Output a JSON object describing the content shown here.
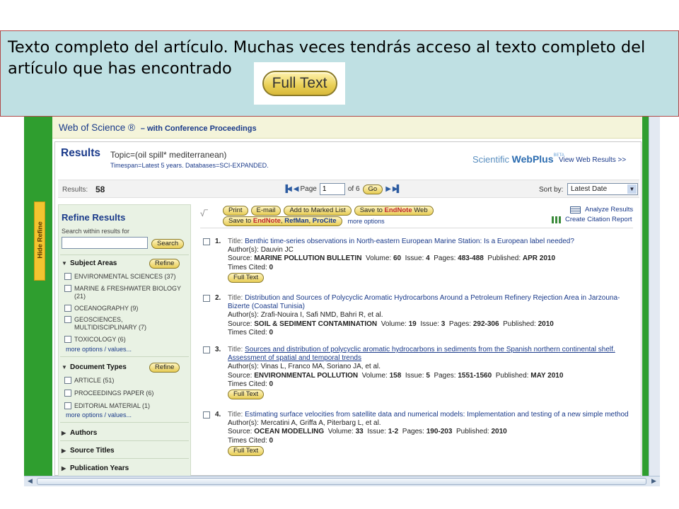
{
  "caption": {
    "text": "Texto completo del artículo. Muchas veces tendrás acceso al texto completo del artículo que has encontrado",
    "full_text_button": "Full Text"
  },
  "header": {
    "brand": "Web of Science ®",
    "subtitle": "– with Conference Proceedings"
  },
  "results_header": {
    "label": "Results",
    "topic": "Topic=(oil spill* mediterranean)",
    "timespan": "Timespan=Latest 5 years. Databases=SCI-EXPANDED.",
    "logo_a": "Scientific",
    "logo_b": "WebPlus",
    "logo_beta": "BETA",
    "view_web": "View Web Results >>"
  },
  "nav": {
    "results_label": "Results:",
    "results_count": "58",
    "page_label": "Page",
    "page_value": "1",
    "of_label": "of 6",
    "go_label": "Go",
    "sortby_label": "Sort by:",
    "sortby_value": "Latest Date"
  },
  "hide_tab": "Hide Refine",
  "sidebar": {
    "title": "Refine Results",
    "search_hint": "Search within results for",
    "search_button": "Search",
    "refine_label": "Refine",
    "subject_areas": {
      "title": "Subject Areas",
      "items": [
        "ENVIRONMENTAL SCIENCES (37)",
        "MARINE & FRESHWATER BIOLOGY (21)",
        "OCEANOGRAPHY (9)",
        "GEOSCIENCES, MULTIDISCIPLINARY (7)",
        "TOXICOLOGY (6)"
      ],
      "more": "more options / values..."
    },
    "document_types": {
      "title": "Document Types",
      "items": [
        "ARTICLE (51)",
        "PROCEEDINGS PAPER (6)",
        "EDITORIAL MATERIAL (1)"
      ],
      "more": "more options / values..."
    },
    "collapsed": [
      "Authors",
      "Source Titles",
      "Publication Years"
    ]
  },
  "toolbar": {
    "print": "Print",
    "email": "E-mail",
    "add_marked": "Add to Marked List",
    "save_to": "Save to",
    "endnote": "EndNote",
    "web": "Web",
    "save_to_2": "Save to",
    "endnote_2": "EndNote",
    "refman": "RefMan",
    "procite": "ProCite",
    "more_options": "more options",
    "analyze": "Analyze Results",
    "citation_report": "Create Citation Report"
  },
  "labels": {
    "title": "Title:",
    "authors": "Author(s):",
    "source": "Source:",
    "volume": "Volume:",
    "issue": "Issue:",
    "pages": "Pages:",
    "published": "Published:",
    "times_cited": "Times Cited:",
    "full_text": "Full Text"
  },
  "records": [
    {
      "num": "1.",
      "title": "Benthic time-series observations in North-eastern European Marine Station: Is a European label needed?",
      "authors": "Dauvin JC",
      "source": "MARINE POLLUTION BULLETIN",
      "volume": "60",
      "issue": "4",
      "pages": "483-488",
      "published": "APR 2010",
      "times_cited": "0"
    },
    {
      "num": "2.",
      "title": "Distribution and Sources of Polycyclic Aromatic Hydrocarbons Around a Petroleum Refinery Rejection Area in Jarzouna-Bizerte (Coastal Tunisia)",
      "authors": "Zrafi-Nouira I, Safi NMD, Bahri R, et al.",
      "source": "SOIL & SEDIMENT CONTAMINATION",
      "volume": "19",
      "issue": "3",
      "pages": "292-306",
      "published": "2010",
      "times_cited": "0"
    },
    {
      "num": "3.",
      "title": "Sources and distribution of polycyclic aromatic hydrocarbons in sediments from the Spanish northern continental shelf. Assessment of spatial and temporal trends",
      "authors": "Vinas L, Franco MA, Soriano JA, et al.",
      "source": "ENVIRONMENTAL POLLUTION",
      "volume": "158",
      "issue": "5",
      "pages": "1551-1560",
      "published": "MAY 2010",
      "times_cited": "0"
    },
    {
      "num": "4.",
      "title": "Estimating surface velocities from satellite data and numerical models: Implementation and testing of a new simple method",
      "authors": "Mercatini A, Griffa A, Piterbarg L, et al.",
      "source": "OCEAN MODELLING",
      "volume": "33",
      "issue": "1-2",
      "pages": "190-203",
      "published": "2010",
      "times_cited": "0"
    }
  ]
}
